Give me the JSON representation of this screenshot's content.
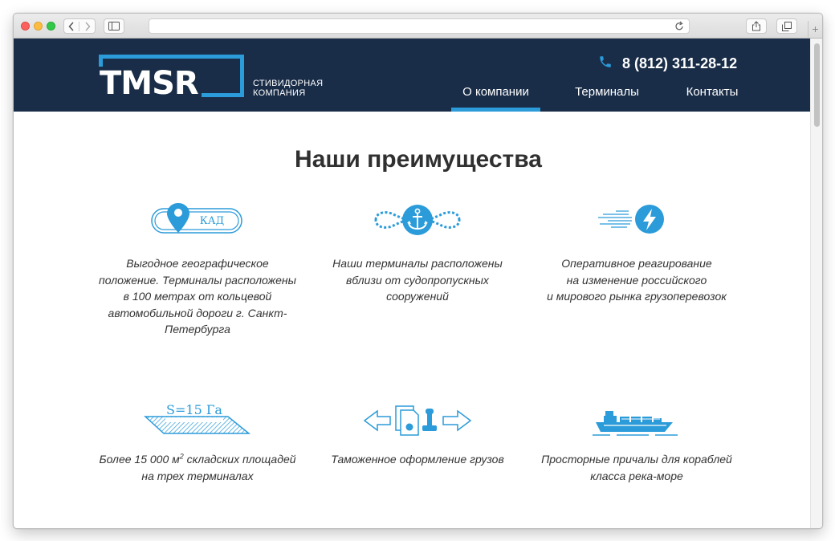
{
  "header": {
    "logo": "TMSR",
    "logo_sub": [
      "СТИВИДОРНАЯ",
      "КОМПАНИЯ"
    ],
    "phone": "8 (812) 311-28-12",
    "nav": [
      {
        "label": "О компании",
        "active": true
      },
      {
        "label": "Терминалы",
        "active": false
      },
      {
        "label": "Контакты",
        "active": false
      }
    ]
  },
  "section": {
    "title": "Наши преимущества"
  },
  "features": [
    {
      "icon": "map-pin-kad-icon",
      "badge": "КАД",
      "text": "Выгодное географическое\nположение. Терминалы расположены\nв 100 метрах от кольцевой\nавтомобильной дороги г. Санкт-\nПетербурга"
    },
    {
      "icon": "anchor-rope-icon",
      "text": "Наши терминалы расположены\nвблизи от судопропускных\nсооружений"
    },
    {
      "icon": "lightning-speed-icon",
      "text": "Оперативное реагирование\nна изменение российского\nи мирового рынка грузоперевозок"
    },
    {
      "icon": "area-plot-icon",
      "badge": "S=15 Га",
      "text_pre": "Более 15 000 м",
      "text_sup": "2",
      "text_post": " складских площадей\nна трех терминалах"
    },
    {
      "icon": "customs-documents-icon",
      "text": "Таможенное оформление грузов"
    },
    {
      "icon": "cargo-ship-icon",
      "text": "Просторные причалы для кораблей\nкласса река-море"
    }
  ],
  "colors": {
    "header_bg": "#192d48",
    "accent": "#2b9bd9",
    "text": "#333333"
  }
}
